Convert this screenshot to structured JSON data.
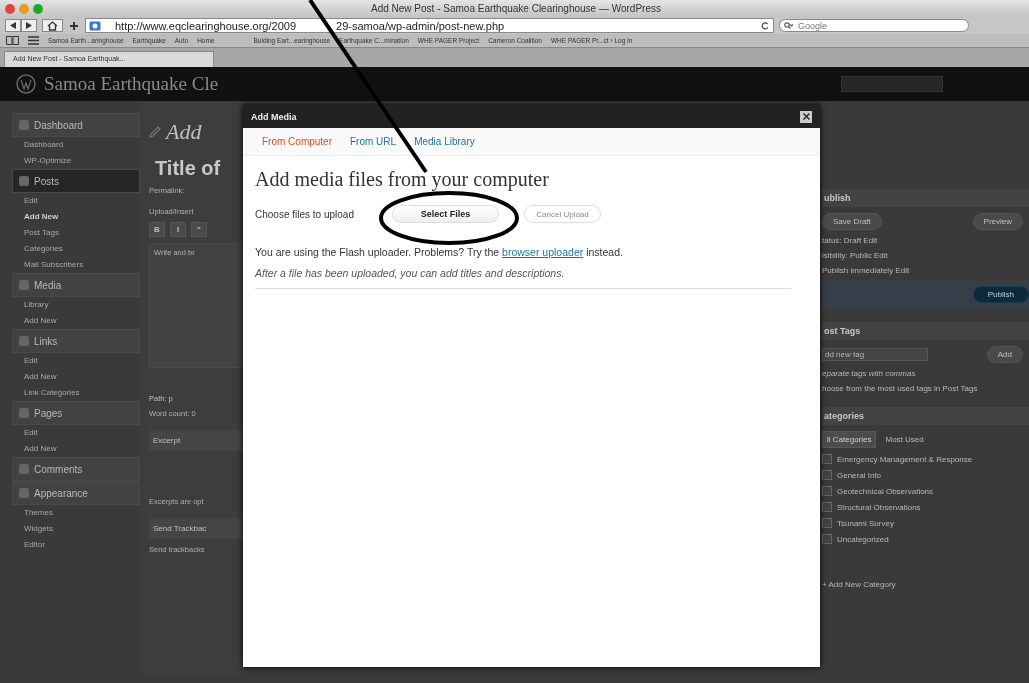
{
  "browser": {
    "title": "Add New Post - Samoa Earthquake Clearinghouse — WordPress",
    "url_parts": [
      "http://www.eqclearinghouse.org/2009",
      "29-samoa/wp-admin/post-new.php"
    ],
    "search_placeholder": "Google",
    "bookmarks": [
      "Samoa Earth...aringhouse",
      "Earthquake",
      "Auto",
      "Home",
      "Bulding Eart...earinghouse",
      "Earthquake C...mination",
      "WHE PAGER Project",
      "Cameron Coalition",
      "WHE PAGER Pr...ct › Log In"
    ],
    "tabs": [
      {
        "label": "Add New Post - Samoa Earthquak...",
        "selected": true
      }
    ]
  },
  "site_header": {
    "title": "Samoa Earthquake Cle"
  },
  "sidebar": {
    "sections": [
      {
        "label": "Dashboard",
        "selected": false,
        "items": [
          {
            "label": "Dashboard",
            "current": false
          },
          {
            "label": "WP-Optimize",
            "current": false
          }
        ]
      },
      {
        "label": "Posts",
        "selected": true,
        "items": [
          {
            "label": "Edit",
            "current": false
          },
          {
            "label": "Add New",
            "current": true
          },
          {
            "label": "Post Tags",
            "current": false
          },
          {
            "label": "Categories",
            "current": false
          },
          {
            "label": "Mail Subscribers",
            "current": false
          }
        ]
      },
      {
        "label": "Media",
        "selected": false,
        "items": [
          {
            "label": "Library",
            "current": false
          },
          {
            "label": "Add New",
            "current": false
          }
        ]
      },
      {
        "label": "Links",
        "selected": false,
        "items": [
          {
            "label": "Edit",
            "current": false
          },
          {
            "label": "Add New",
            "current": false
          },
          {
            "label": "Link Categories",
            "current": false
          }
        ]
      },
      {
        "label": "Pages",
        "selected": false,
        "items": [
          {
            "label": "Edit",
            "current": false
          },
          {
            "label": "Add New",
            "current": false
          }
        ]
      },
      {
        "label": "Comments",
        "selected": false
      },
      {
        "label": "Appearance",
        "selected": false,
        "items": [
          {
            "label": "Themes",
            "current": false
          },
          {
            "label": "Widgets",
            "current": false
          },
          {
            "label": "Editor",
            "current": false
          }
        ]
      }
    ]
  },
  "editor": {
    "heading": "Add",
    "title": "Title of",
    "permalink": "Permalink:",
    "upload": "Upload/Insert",
    "toolbar": [
      "B",
      "I",
      "“"
    ],
    "body": "Write and br",
    "path": "Path: p",
    "word_count": "Word count: 0",
    "excerpt": "Excerpt",
    "excerpt_note": "Excerpts are opt",
    "trackbacks": "Send Trackbac",
    "trackbacks_note": "Send trackbacks"
  },
  "publish": {
    "heading": "ublish",
    "save": "Save Draft",
    "preview": "Preview",
    "lines": [
      "tatus: Draft Edit",
      "isibility: Public Edit",
      "Publish immediately Edit"
    ],
    "button": "Publish"
  },
  "tags": {
    "heading": "ost Tags",
    "placeholder": "dd new tag",
    "add": "Add",
    "hint": "eparate tags with commas",
    "link": "hoose from the most used tags in Post Tags"
  },
  "categories": {
    "heading": "ategories",
    "tabs": [
      {
        "label": "ll Categories",
        "selected": true
      },
      {
        "label": "Most Used",
        "selected": false
      }
    ],
    "items": [
      {
        "label": "Emergency Management & Response",
        "checked": false
      },
      {
        "label": "General Info",
        "checked": false
      },
      {
        "label": "Geotechnical Observations",
        "checked": false
      },
      {
        "label": "Structural Observations",
        "checked": false
      },
      {
        "label": "Tsunami Survey",
        "checked": false
      },
      {
        "label": "Uncategorized",
        "checked": false
      }
    ],
    "add_link": "+ Add New Category"
  },
  "modal": {
    "title": "Add Media",
    "tabs": [
      {
        "label": "From Computer",
        "selected": true
      },
      {
        "label": "From URL",
        "selected": false
      },
      {
        "label": "Media Library",
        "selected": false
      }
    ],
    "heading": "Add media files from your computer",
    "choose_label": "Choose files to upload",
    "select_button": "Select Files",
    "cancel_button": "Cancel Upload",
    "cancel_disabled": true,
    "flash_note": {
      "before": "You are using the Flash uploader. Problems? Try the",
      "link": "browser uploader",
      "after": "instead."
    },
    "after_note": "After a file has been uploaded, you can add titles and descriptions."
  }
}
